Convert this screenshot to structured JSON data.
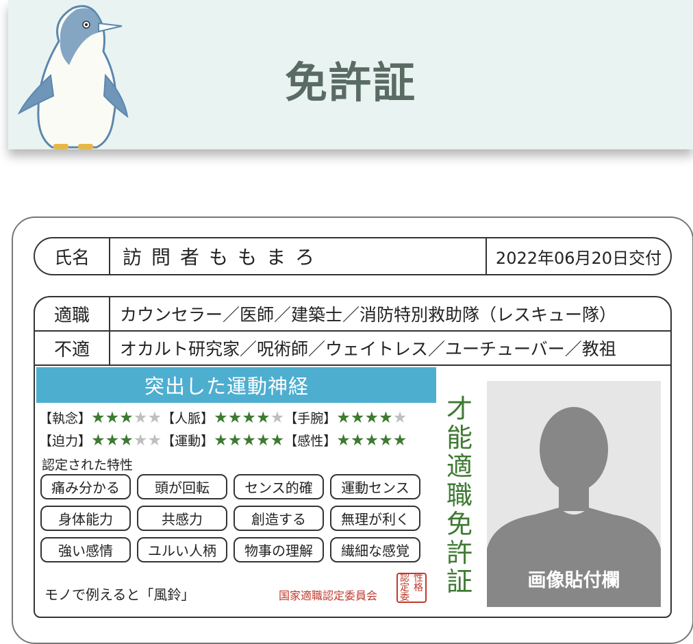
{
  "header": {
    "title": "免許証"
  },
  "license": {
    "name_label": "氏名",
    "name": "訪問者ももまろ",
    "issued": "2022年06月20日交付",
    "suitable_label": "適職",
    "suitable": "カウンセラー／医師／建築士／消防特別救助隊（レスキュー隊）",
    "unsuitable_label": "不適",
    "unsuitable": "オカルト研究家／呪術師／ウェイトレス／ユーチューバー／教祖",
    "talent": "突出した運動神経",
    "stats": [
      [
        {
          "label": "【執念】",
          "stars": 3
        },
        {
          "label": "【人脈】",
          "stars": 4
        },
        {
          "label": "【手腕】",
          "stars": 4
        }
      ],
      [
        {
          "label": "【迫力】",
          "stars": 3
        },
        {
          "label": "【運動】",
          "stars": 5
        },
        {
          "label": "【感性】",
          "stars": 5
        }
      ]
    ],
    "star_max": 5,
    "traits_label": "認定された特性",
    "traits": [
      "痛み分かる",
      "頭が回転",
      "センス的確",
      "運動センス",
      "身体能力",
      "共感力",
      "創造する",
      "無理が利く",
      "強い感情",
      "ユルい人柄",
      "物事の理解",
      "繊細な感覚"
    ],
    "mono_text": "モノで例えると「風鈴」",
    "committee": "国家適職認定委員会",
    "seal_chars": [
      "認",
      "性",
      "定",
      "格",
      "委",
      ""
    ],
    "vertical_title": "才能適職免許証",
    "photo_label": "画像貼付欄"
  },
  "colors": {
    "talent_bar": "#4eaed0",
    "star": "#3e7a32",
    "seal": "#c0392b",
    "banner": "#e9f3f2"
  }
}
